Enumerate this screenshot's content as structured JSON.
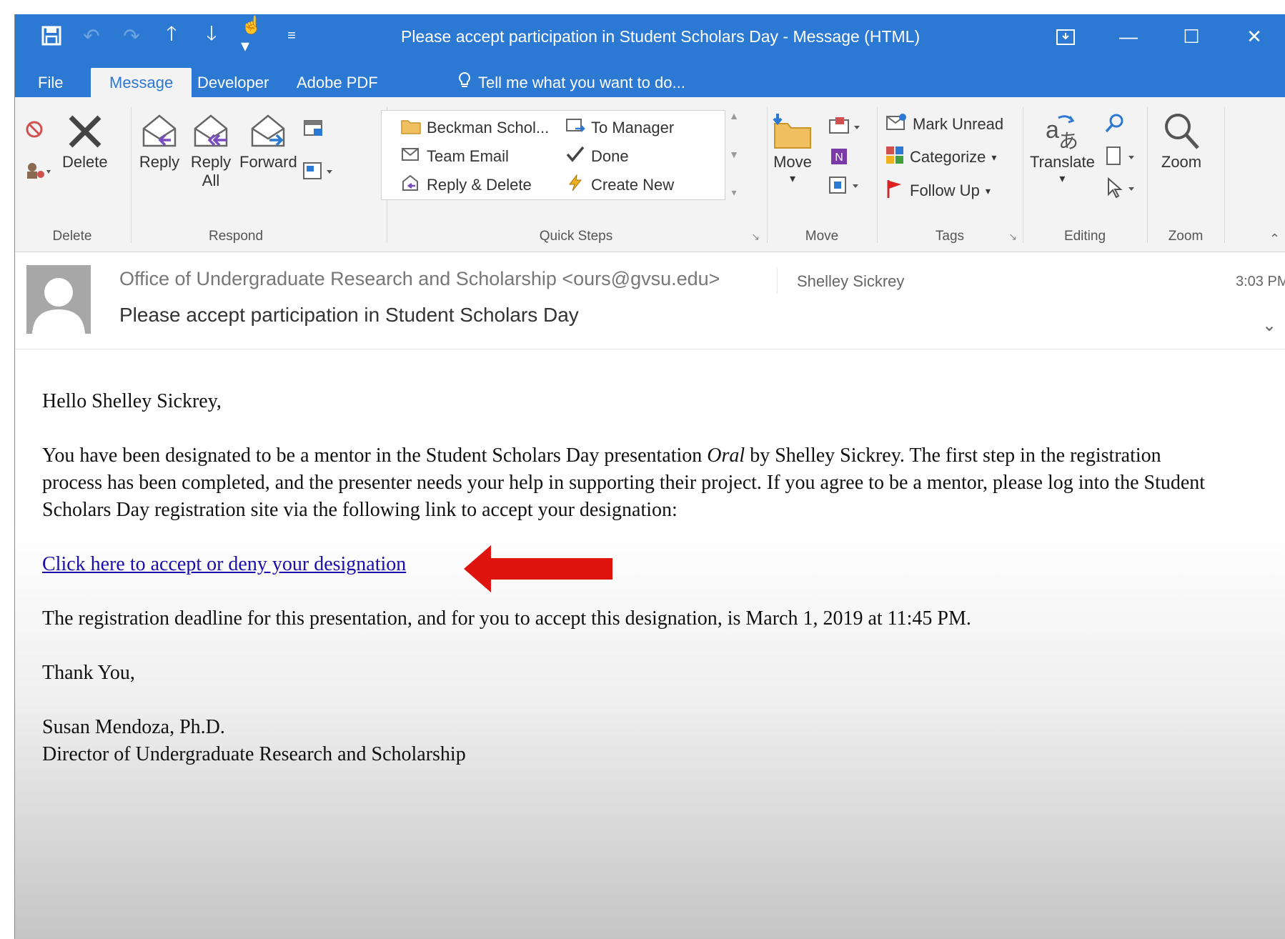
{
  "window": {
    "title": "Please accept participation in Student Scholars Day - Message (HTML)"
  },
  "tabs": [
    {
      "label": "File"
    },
    {
      "label": "Message"
    },
    {
      "label": "Developer"
    },
    {
      "label": "Adobe PDF"
    }
  ],
  "tell_me": "Tell me what you want to do...",
  "ribbon": {
    "delete": {
      "label": "Delete",
      "group": "Delete"
    },
    "respond": {
      "reply": "Reply",
      "reply_all_1": "Reply",
      "reply_all_2": "All",
      "forward": "Forward",
      "group": "Respond"
    },
    "quick_steps": {
      "items": [
        "Beckman Schol...",
        "To Manager",
        "Team Email",
        "Done",
        "Reply & Delete",
        "Create New"
      ],
      "group": "Quick Steps"
    },
    "move": {
      "label": "Move",
      "group": "Move"
    },
    "tags": {
      "mark_unread": "Mark Unread",
      "categorize": "Categorize",
      "follow_up": "Follow Up",
      "group": "Tags"
    },
    "editing": {
      "translate": "Translate",
      "group": "Editing"
    },
    "zoom": {
      "label": "Zoom",
      "group": "Zoom"
    }
  },
  "message": {
    "from": "Office of Undergraduate Research and Scholarship <ours@gvsu.edu>",
    "to": "Shelley Sickrey",
    "time": "3:03 PM",
    "subject": "Please accept participation in Student Scholars Day",
    "greeting": "Hello Shelley Sickrey,",
    "para1_a": "You have been designated to be a mentor in the Student Scholars Day presentation ",
    "para1_em": "Oral",
    "para1_b": " by Shelley Sickrey. The first step in the registration process has been completed, and the presenter needs your help in supporting their project. If you agree to be a mentor, please log into the Student Scholars Day registration site via the following link to accept your designation:",
    "link": "Click here to accept or deny your designation",
    "deadline": "The registration deadline for this presentation, and for you to accept this designation, is March 1, 2019 at 11:45 PM.",
    "closing": "Thank You,",
    "signature_name": "Susan Mendoza, Ph.D.",
    "signature_title": "Director of Undergraduate Research and Scholarship"
  },
  "colors": {
    "accent": "#2b79d3",
    "arrow": "#e0140f",
    "link": "#1a0dab"
  }
}
